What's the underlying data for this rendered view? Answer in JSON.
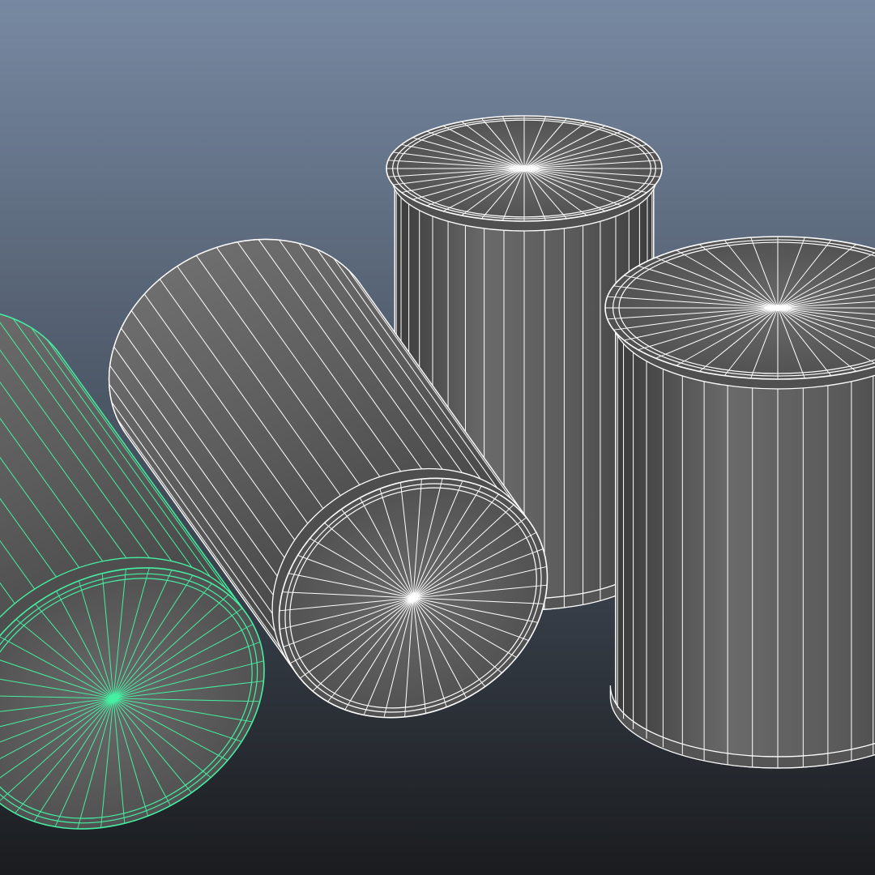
{
  "viewport": {
    "background": {
      "top_color": "#7789a2",
      "bottom_color": "#1a1c1f"
    },
    "wireframe_color": "#ffffff",
    "selection_color": "#44f0a2",
    "shading_color": "#5e5e5e"
  },
  "objects": [
    {
      "id": "cylinder-selected-lying",
      "orientation": "lying",
      "selected": true,
      "segments": 40
    },
    {
      "id": "cylinder-lying",
      "orientation": "lying",
      "selected": false,
      "segments": 40
    },
    {
      "id": "cylinder-standing-back",
      "orientation": "standing",
      "selected": false,
      "segments": 40
    },
    {
      "id": "cylinder-standing-front",
      "orientation": "standing",
      "selected": false,
      "segments": 40
    }
  ]
}
